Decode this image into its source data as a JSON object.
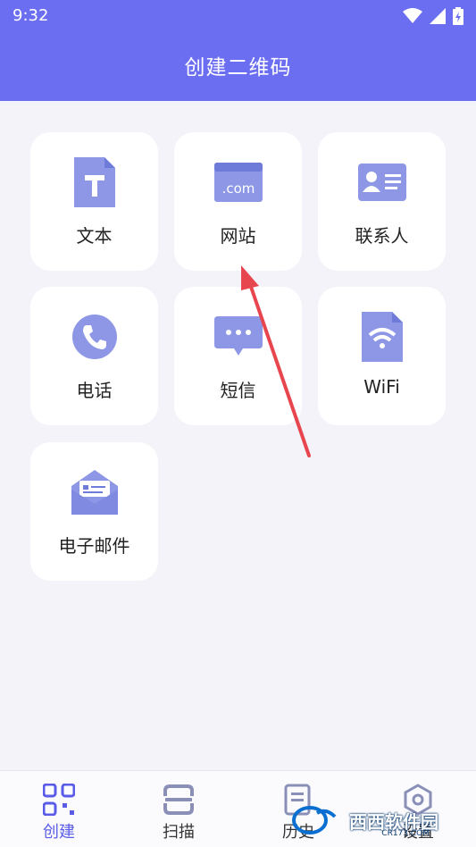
{
  "status": {
    "time": "9:32"
  },
  "header": {
    "title": "创建二维码"
  },
  "cards": [
    {
      "label": "文本",
      "icon": "text-document-icon"
    },
    {
      "label": "网站",
      "icon": "website-icon",
      "icon_text": ".com"
    },
    {
      "label": "联系人",
      "icon": "contact-card-icon"
    },
    {
      "label": "电话",
      "icon": "phone-icon"
    },
    {
      "label": "短信",
      "icon": "sms-bubble-icon"
    },
    {
      "label": "WiFi",
      "icon": "wifi-file-icon"
    },
    {
      "label": "电子邮件",
      "icon": "email-envelope-icon"
    }
  ],
  "tabs": [
    {
      "label": "创建",
      "icon": "qr-code-icon",
      "active": true
    },
    {
      "label": "扫描",
      "icon": "scan-icon",
      "active": false
    },
    {
      "label": "历史",
      "icon": "history-icon",
      "active": false
    },
    {
      "label": "设置",
      "icon": "settings-icon",
      "active": false
    }
  ],
  "watermark": {
    "text": "西西软件园",
    "sub": "CR173.COM"
  },
  "colors": {
    "header": "#6c6ef2",
    "icon": "#8d97e6",
    "icon_dark": "#6f7bd9",
    "arrow": "#e8464f"
  }
}
